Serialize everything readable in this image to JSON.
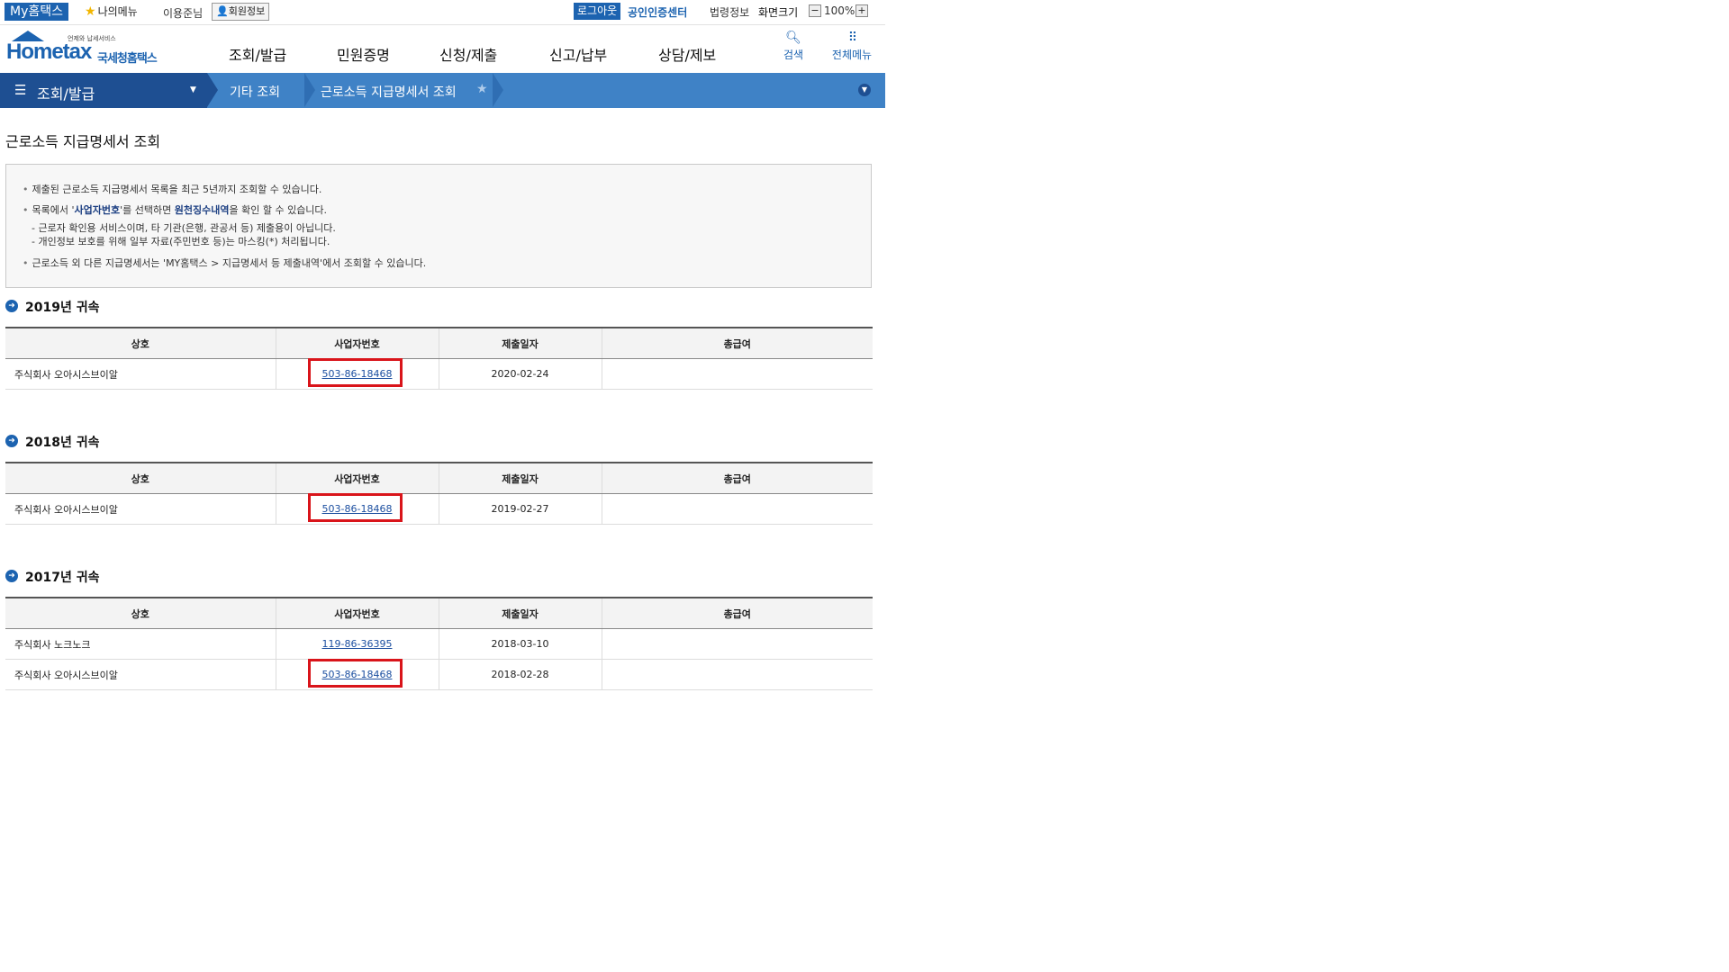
{
  "topbar": {
    "my_hometax": "My홈택스",
    "my_menu": "나의메뉴",
    "user_name": "이용준님",
    "member_info": "회원정보",
    "logout": "로그아웃",
    "cert_center": "공인인증센터",
    "laws_info": "법령정보",
    "screen_size": "화면크기",
    "zoom_minus": "−",
    "zoom_level": "100%",
    "zoom_plus": "+"
  },
  "header": {
    "logo_sub": "언제와 납세서비스",
    "logo_main": "Hometax",
    "logo_kor": "국세청홈택스",
    "nav": [
      "조회/발급",
      "민원증명",
      "신청/제출",
      "신고/납부",
      "상담/제보"
    ],
    "search_label": "검색",
    "all_menu_label": "전체메뉴",
    "icons": {
      "search": "search-icon",
      "all_menu": "grid-icon"
    }
  },
  "location": {
    "main": "조회/발급",
    "items": [
      "기타 조회",
      "근로소득 지급명세서 조회"
    ],
    "icons": {
      "menu": "hamburger-icon",
      "favorite": "star-icon",
      "expand": "chevron-down-icon"
    }
  },
  "page": {
    "title": "근로소득 지급명세서 조회",
    "notice": {
      "line1": "제출된 근로소득 지급명세서 목록을 최근 5년까지 조회할 수 있습니다.",
      "line2_pre": "목록에서 '",
      "line2_b1": "사업자번호",
      "line2_mid": "'를 선택하면 ",
      "line2_b2": "원천징수내역",
      "line2_post": "을 확인 할 수 있습니다.",
      "line3": "- 근로자 확인용 서비스이며, 타 기관(은행, 관공서 등) 제출용이 아닙니다.",
      "line4": "- 개인정보 보호를 위해 일부 자료(주민번호 등)는 마스킹(*) 처리됩니다.",
      "line5": "근로소득 외 다른 지급명세서는 'MY홈택스 > 지급명세서 등 제출내역'에서 조회할 수 있습니다."
    },
    "columns": [
      "상호",
      "사업자번호",
      "제출일자",
      "총급여"
    ],
    "sections": [
      {
        "title": "2019년 귀속",
        "rows": [
          {
            "company": "주식회사 오아시스브이알",
            "biz_no": "503-86-18468",
            "date": "2020-02-24",
            "total": ""
          }
        ]
      },
      {
        "title": "2018년 귀속",
        "rows": [
          {
            "company": "주식회사 오아시스브이알",
            "biz_no": "503-86-18468",
            "date": "2019-02-27",
            "total": ""
          }
        ]
      },
      {
        "title": "2017년 귀속",
        "rows": [
          {
            "company": "주식회사 노크노크",
            "biz_no": "119-86-36395",
            "date": "2018-03-10",
            "total": ""
          },
          {
            "company": "주식회사 오아시스브이알",
            "biz_no": "503-86-18468",
            "date": "2018-02-28",
            "total": ""
          }
        ]
      }
    ]
  },
  "colors": {
    "brand_blue": "#1c63b0",
    "location_dark": "#1e4f92",
    "location_light": "#3f82c6",
    "highlight_red": "#d9141a"
  }
}
